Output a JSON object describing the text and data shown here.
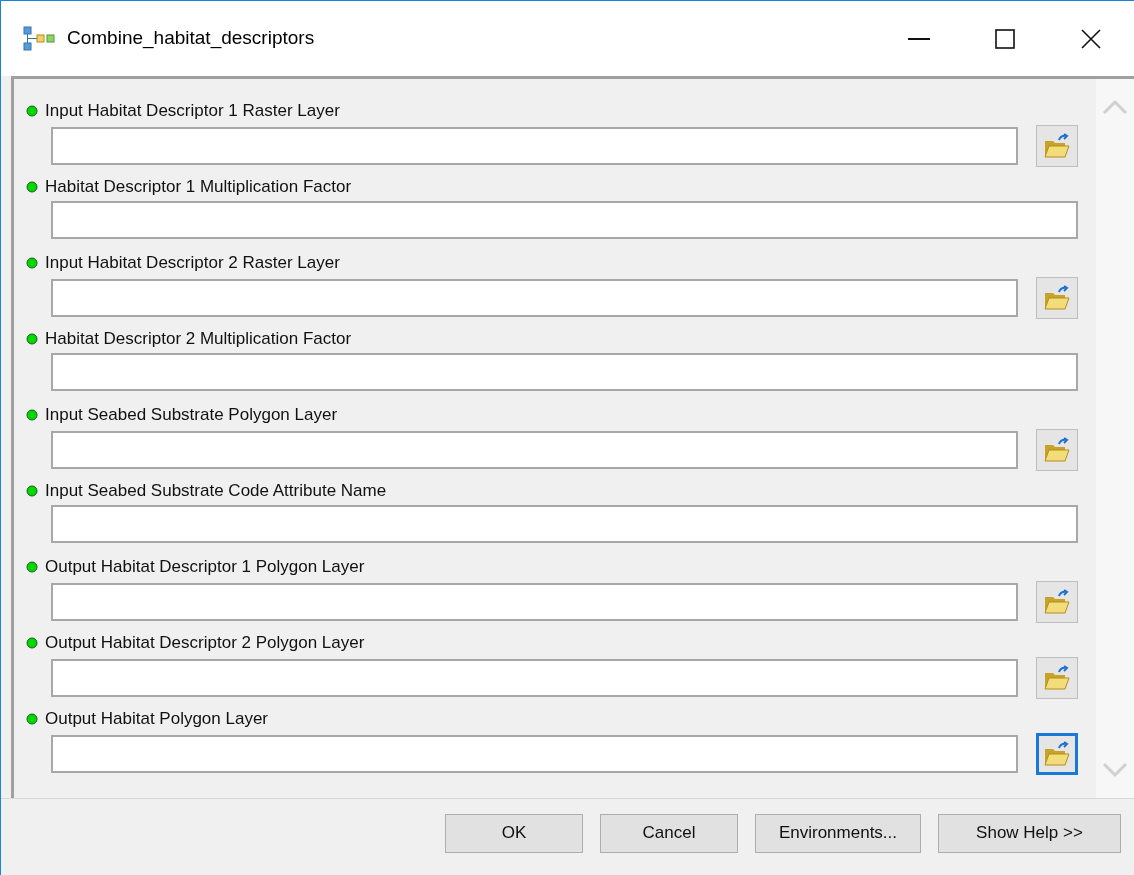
{
  "window": {
    "title": "Combine_habitat_descriptors"
  },
  "parameters": [
    {
      "label": "Input Habitat Descriptor 1 Raster Layer",
      "kind": "path",
      "browse_focused": false
    },
    {
      "label": "Habitat Descriptor 1 Multiplication Factor",
      "kind": "value"
    },
    {
      "label": "Input Habitat Descriptor 2 Raster Layer",
      "kind": "path",
      "browse_focused": false
    },
    {
      "label": "Habitat Descriptor 2 Multiplication Factor",
      "kind": "value"
    },
    {
      "label": "Input Seabed Substrate Polygon Layer",
      "kind": "path",
      "browse_focused": false
    },
    {
      "label": "Input Seabed Substrate Code Attribute Name",
      "kind": "value"
    },
    {
      "label": "Output Habitat Descriptor 1 Polygon Layer",
      "kind": "path",
      "browse_focused": false
    },
    {
      "label": "Output Habitat Descriptor 2 Polygon Layer",
      "kind": "path",
      "browse_focused": false
    },
    {
      "label": "Output Habitat Polygon Layer",
      "kind": "path",
      "browse_focused": true
    }
  ],
  "buttons": [
    "OK",
    "Cancel",
    "Environments...",
    "Show Help >>"
  ]
}
